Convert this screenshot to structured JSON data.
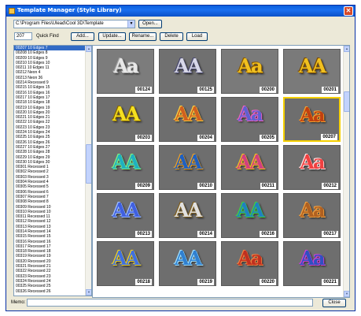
{
  "window": {
    "title": "Template Manager (Style Library)",
    "close_glyph": "✕"
  },
  "toolbar": {
    "path_value": "C:\\Program Files\\Ulead\\Cool 3D\\Template",
    "open_label": "Open...",
    "position_value": "207",
    "quick_find_label": "Quick Find",
    "add_label": "Add...",
    "update_label": "Update...",
    "rename_label": "Rename...",
    "delete_label": "Delete",
    "load_label": "Load"
  },
  "style_list": [
    "00207 10 Edges 7",
    "00208 10 Edges 8",
    "00209 10 Edges 9",
    "00210 10 Edges 10",
    "00211 10 Edges 11",
    "00212 Neon 4",
    "00213 Neon 36",
    "00214 Recessed 9",
    "00215 10 Edges 15",
    "00216 10 Edges 16",
    "00217 10 Edges 17",
    "00218 10 Edges 18",
    "00219 10 Edges 19",
    "00220 10 Edges 20",
    "00221 10 Edges 21",
    "00222 10 Edges 22",
    "00223 10 Edges 23",
    "00224 10 Edges 24",
    "00225 10 Edges 25",
    "00226 10 Edges 26",
    "00227 10 Edges 27",
    "00228 10 Edges 28",
    "00229 10 Edges 29",
    "00230 10 Edges 30",
    "00301 Recessed 1",
    "00302 Recessed 2",
    "00303 Recessed 3",
    "00304 Recessed 4",
    "00305 Recessed 5",
    "00306 Recessed 6",
    "00307 Recessed 7",
    "00308 Recessed 8",
    "00309 Recessed 10",
    "00310 Recessed 10",
    "00311 Recessed 11",
    "00312 Recessed 12",
    "00313 Recessed 13",
    "00314 Recessed 14",
    "00315 Recessed 15",
    "00316 Recessed 16",
    "00317 Recessed 17",
    "00318 Recessed 18",
    "00319 Recessed 19",
    "00320 Recessed 20",
    "00321 Recessed 21",
    "00322 Recessed 22",
    "00323 Recessed 23",
    "00324 Recessed 24",
    "00325 Recessed 25",
    "00326 Recessed 26"
  ],
  "selected_index": 0,
  "thumbnails": [
    {
      "label": "00124",
      "text": "Aa",
      "color": "#e8e8e8",
      "accent": "#a0a0a0",
      "bg": "#7c7c7c"
    },
    {
      "label": "00125",
      "text": "AA",
      "color": "#d8d8e8",
      "accent": "#4a4a70",
      "bg": "#707070"
    },
    {
      "label": "00200",
      "text": "Aa",
      "color": "#f0c020",
      "accent": "#8a5a00",
      "bg": "#7a7a7a"
    },
    {
      "label": "00201",
      "text": "AA",
      "color": "#f0c020",
      "accent": "#7a4a00",
      "bg": "#7a7a7a"
    },
    {
      "label": "00203",
      "text": "AA",
      "color": "#f4e020",
      "accent": "#8a6a00",
      "bg": "#6e6e6e"
    },
    {
      "label": "00204",
      "text": "AA",
      "color": "#d06020",
      "accent": "#f8d040",
      "bg": "#6e6e6e"
    },
    {
      "label": "00205",
      "text": "Aa",
      "color": "#6060d0",
      "accent": "#f060c0",
      "bg": "#6e6e6e"
    },
    {
      "label": "00207",
      "text": "Aa",
      "color": "#c04010",
      "accent": "#f0a030",
      "bg": "#6e6e6e"
    },
    {
      "label": "00209",
      "text": "AA",
      "color": "#20b0c0",
      "accent": "#80f080",
      "bg": "#6e6e6e"
    },
    {
      "label": "00210",
      "text": "AA",
      "color": "#2060c0",
      "accent": "#f0a020",
      "bg": "#6e6e6e"
    },
    {
      "label": "00211",
      "text": "AA",
      "color": "#d04080",
      "accent": "#f0c020",
      "bg": "#6e6e6e"
    },
    {
      "label": "00212",
      "text": "Aa",
      "color": "#f04040",
      "accent": "#ffe0e0",
      "bg": "#6e6e6e"
    },
    {
      "label": "00213",
      "text": "AA",
      "color": "#4060e0",
      "accent": "#a0c0ff",
      "bg": "#6e6e6e"
    },
    {
      "label": "00214",
      "text": "AA",
      "color": "#e0e0e0",
      "accent": "#806020",
      "bg": "#6e6e6e"
    },
    {
      "label": "00216",
      "text": "AA",
      "color": "#2080c0",
      "accent": "#40d040",
      "bg": "#6e6e6e"
    },
    {
      "label": "00217",
      "text": "Aa",
      "color": "#b06020",
      "accent": "#f0a040",
      "bg": "#6e6e6e"
    },
    {
      "label": "00218",
      "text": "AA",
      "color": "#4070e0",
      "accent": "#f0d020",
      "bg": "#6e6e6e"
    },
    {
      "label": "00219",
      "text": "AA",
      "color": "#3080d0",
      "accent": "#a0e0ff",
      "bg": "#6e6e6e"
    },
    {
      "label": "00220",
      "text": "Aa",
      "color": "#c03020",
      "accent": "#f08040",
      "bg": "#6e6e6e"
    },
    {
      "label": "00221",
      "text": "Aa",
      "color": "#3050c0",
      "accent": "#d040d0",
      "bg": "#6e6e6e"
    }
  ],
  "selected_thumbnail": "00207",
  "memo": {
    "label": "Memo:",
    "value": ""
  },
  "close_label": "Close"
}
